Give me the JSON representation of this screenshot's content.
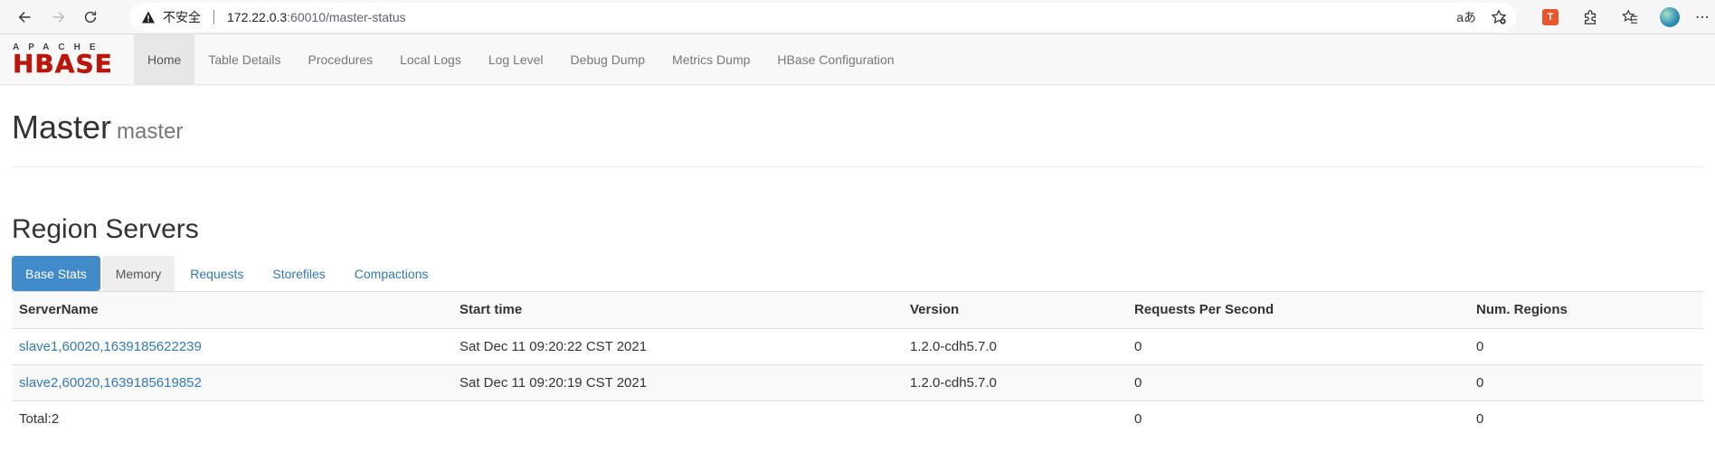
{
  "browser": {
    "insecure_label": "不安全",
    "url_host": "172.22.0.3",
    "url_rest": ":60010/master-status",
    "read_aloud_icon": "aあ"
  },
  "logo": {
    "top": "APACHE",
    "main": "HBASE"
  },
  "nav": {
    "items": [
      {
        "label": "Home"
      },
      {
        "label": "Table Details"
      },
      {
        "label": "Procedures"
      },
      {
        "label": "Local Logs"
      },
      {
        "label": "Log Level"
      },
      {
        "label": "Debug Dump"
      },
      {
        "label": "Metrics Dump"
      },
      {
        "label": "HBase Configuration"
      }
    ]
  },
  "header": {
    "title": "Master",
    "subtitle": "master"
  },
  "region_servers": {
    "title": "Region Servers",
    "tabs": [
      {
        "label": "Base Stats"
      },
      {
        "label": "Memory"
      },
      {
        "label": "Requests"
      },
      {
        "label": "Storefiles"
      },
      {
        "label": "Compactions"
      }
    ],
    "columns": [
      "ServerName",
      "Start time",
      "Version",
      "Requests Per Second",
      "Num. Regions"
    ],
    "rows": [
      {
        "server": "slave1,60020,1639185622239",
        "start": "Sat Dec 11 09:20:22 CST 2021",
        "version": "1.2.0-cdh5.7.0",
        "rps": "0",
        "regions": "0"
      },
      {
        "server": "slave2,60020,1639185619852",
        "start": "Sat Dec 11 09:20:19 CST 2021",
        "version": "1.2.0-cdh5.7.0",
        "rps": "0",
        "regions": "0"
      }
    ],
    "total": {
      "label": "Total:2",
      "rps": "0",
      "regions": "0"
    }
  },
  "colors": {
    "accent": "#428bca",
    "link": "#337ab7",
    "logo_red": "#ba160c"
  }
}
